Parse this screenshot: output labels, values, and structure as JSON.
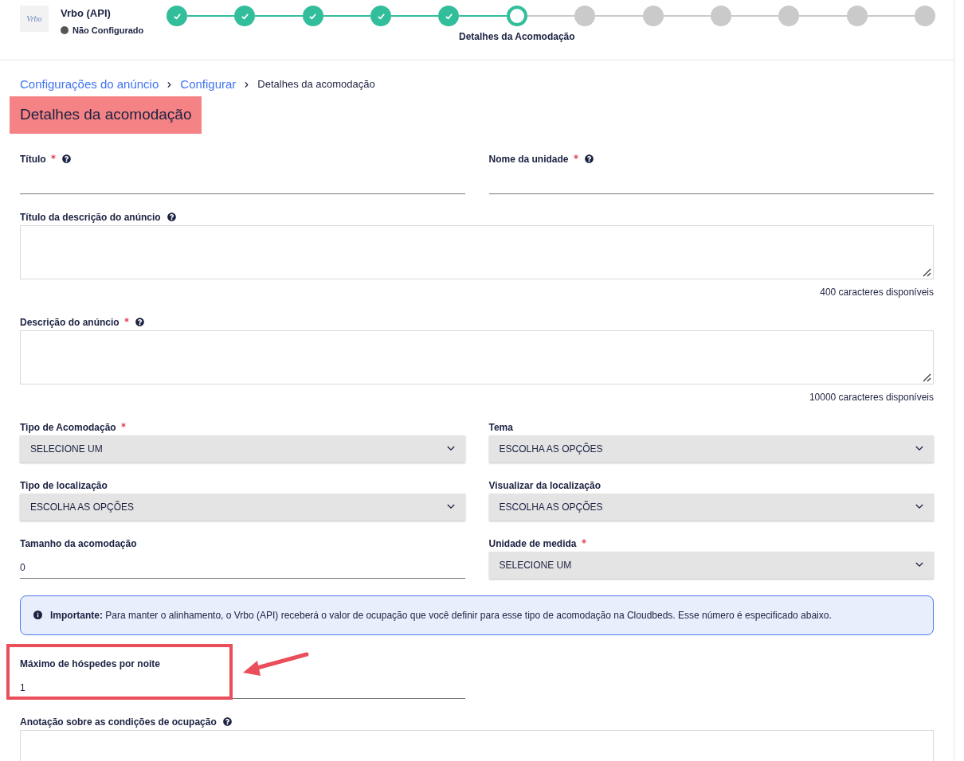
{
  "app": {
    "logo": "Vrbo",
    "name": "Vrbo (API)",
    "status": "Não Configurado",
    "status_indicator": {
      "color": "#555555"
    }
  },
  "steps": [
    {
      "kind": "done"
    },
    {
      "kind": "done"
    },
    {
      "kind": "done"
    },
    {
      "kind": "done"
    },
    {
      "kind": "done"
    },
    {
      "kind": "current",
      "label": "Detalhes da Acomodação"
    },
    {
      "kind": "todo"
    },
    {
      "kind": "todo"
    },
    {
      "kind": "todo"
    },
    {
      "kind": "todo"
    },
    {
      "kind": "todo"
    },
    {
      "kind": "todo"
    }
  ],
  "breadcrumb": [
    {
      "kind": "link",
      "label": "Configurações do anúncio"
    },
    {
      "kind": "link",
      "label": "Configurar"
    },
    {
      "kind": "current",
      "label": "Detalhes da acomodação"
    }
  ],
  "heading": {
    "text": "Detalhes da acomodação",
    "highlighted": true
  },
  "rows": [
    {
      "kind": "fields",
      "fields": [
        {
          "kind": "text",
          "label": "Título",
          "required": true,
          "help": true
        },
        {
          "kind": "text",
          "label": "Nome da unidade",
          "required": true,
          "help": true
        }
      ]
    },
    {
      "kind": "fields",
      "fields": [
        {
          "kind": "textarea",
          "label": "Título da descrição do anúncio",
          "required": false,
          "help": true,
          "counter": "400 caracteres disponíveis"
        }
      ]
    },
    {
      "kind": "fields",
      "fields": [
        {
          "kind": "textarea",
          "label": "Descrição do anúncio",
          "required": true,
          "help": true,
          "counter": "10000 caracteres disponíveis"
        }
      ]
    },
    {
      "kind": "fields",
      "fields": [
        {
          "kind": "select",
          "label": "Tipo de Acomodação",
          "required": true,
          "help": false,
          "value": "SELECIONE UM"
        },
        {
          "kind": "select",
          "label": "Tema",
          "required": false,
          "help": false,
          "value": "ESCOLHA AS OPÇÕES"
        }
      ]
    },
    {
      "kind": "fields",
      "fields": [
        {
          "kind": "select",
          "label": "Tipo de localização",
          "required": false,
          "help": false,
          "value": "ESCOLHA AS OPÇÕES"
        },
        {
          "kind": "select",
          "label": "Visualizar da localização",
          "required": false,
          "help": false,
          "value": "ESCOLHA AS OPÇÕES"
        }
      ]
    },
    {
      "kind": "fields",
      "fields": [
        {
          "kind": "text",
          "label": "Tamanho da acomodação",
          "required": false,
          "help": false,
          "value": "0"
        },
        {
          "kind": "select",
          "label": "Unidade de medida",
          "required": true,
          "help": false,
          "value": "SELECIONE UM"
        }
      ]
    },
    {
      "kind": "notice",
      "text": "**Importante:** Para manter o alinhamento, o Vrbo (API) receberá o valor de ocupação que você definir para esse tipo de acomodação na Cloudbeds. Esse número é especificado abaixo."
    },
    {
      "kind": "fields",
      "fields": [
        {
          "kind": "text",
          "label": "Máximo de hóspedes por noite",
          "required": false,
          "help": false,
          "value": "1",
          "highlighted": true
        }
      ]
    },
    {
      "kind": "fields",
      "fields": [
        {
          "kind": "textarea",
          "label": "Anotação sobre as condições de ocupação",
          "required": false,
          "help": true
        }
      ]
    }
  ]
}
